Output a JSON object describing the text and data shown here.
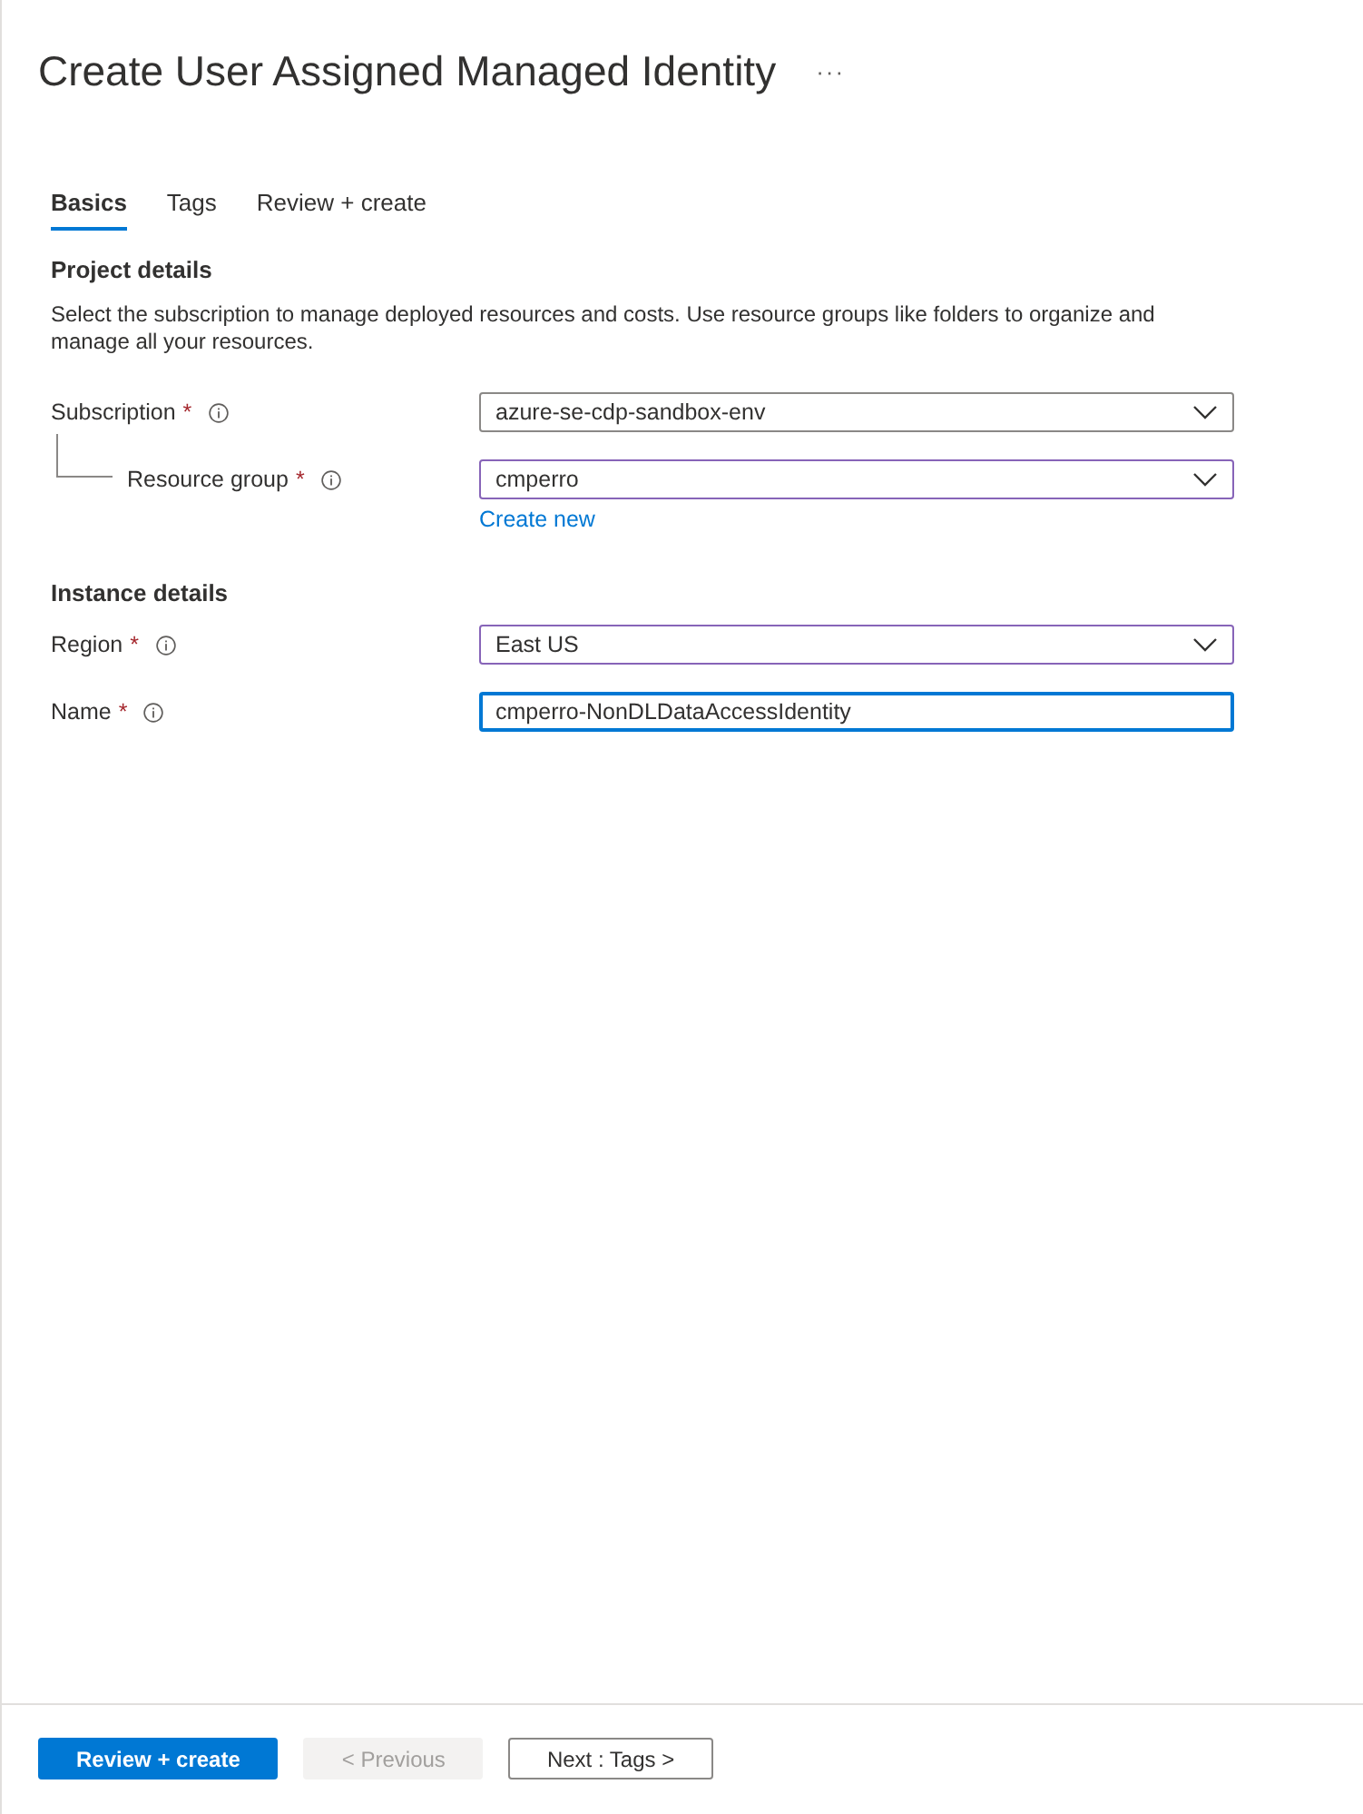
{
  "header": {
    "title": "Create User Assigned Managed Identity",
    "more": "···"
  },
  "tabs": [
    {
      "label": "Basics",
      "selected": true
    },
    {
      "label": "Tags",
      "selected": false
    },
    {
      "label": "Review + create",
      "selected": false
    }
  ],
  "sections": [
    {
      "heading": "Project details",
      "description": "Select the subscription to manage deployed resources and costs. Use resource groups like folders to organize and manage all your resources.",
      "fields": [
        {
          "label": "Subscription",
          "required_mark": "*",
          "kind": "dropdown",
          "value": "azure-se-cdp-sandbox-env",
          "modified": false,
          "focused": false,
          "children": [
            {
              "label": "Resource group",
              "required_mark": "*",
              "kind": "dropdown",
              "value": "cmperro",
              "modified": true,
              "focused": false,
              "link": "Create new"
            }
          ]
        }
      ]
    },
    {
      "heading": "Instance details",
      "fields": [
        {
          "label": "Region",
          "required_mark": "*",
          "kind": "dropdown",
          "value": "East US",
          "modified": true,
          "focused": false
        },
        {
          "label": "Name",
          "required_mark": "*",
          "kind": "text",
          "value": "cmperro-NonDLDataAccessIdentity",
          "modified": false,
          "focused": true
        }
      ]
    }
  ],
  "footer": {
    "buttons": [
      {
        "label": "Review + create",
        "kind": "primary",
        "disabled": false
      },
      {
        "label": "< Previous",
        "kind": "secondary",
        "disabled": true
      },
      {
        "label": "Next : Tags >",
        "kind": "secondary",
        "disabled": false
      }
    ]
  }
}
